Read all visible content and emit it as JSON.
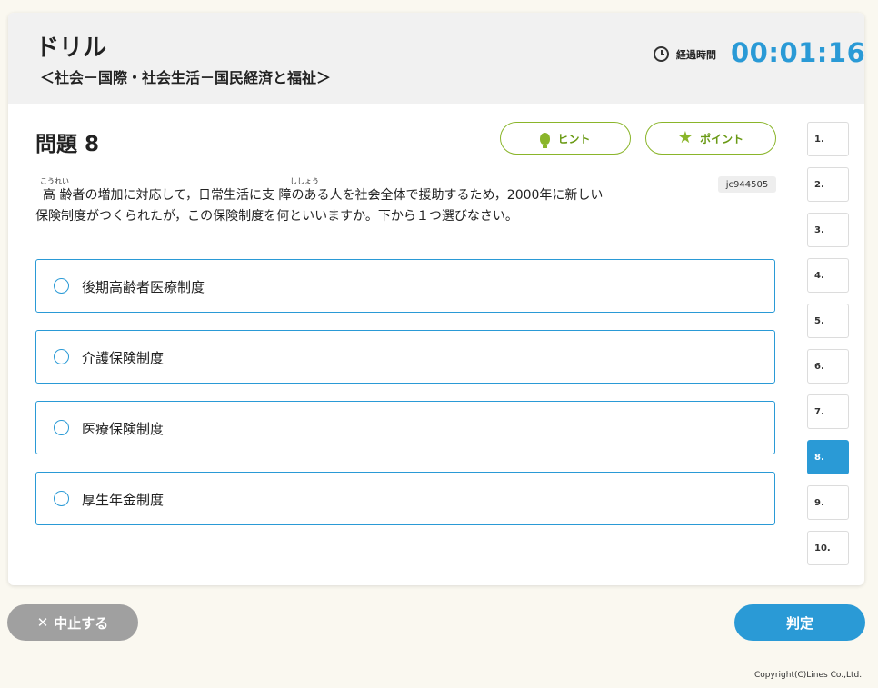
{
  "header": {
    "title": "ドリル",
    "subtitle": "＜社会－国際・社会生活－国民経済と福祉＞",
    "timer_label": "経過時間",
    "timer_value": "00:01:16"
  },
  "question": {
    "title": "問題 8",
    "hint_label": "ヒント",
    "point_label": "ポイント",
    "id": "jc944505",
    "ruby_1": "こうれい",
    "ruby_2": "ししょう",
    "text_line1": "高 齢者の増加に対応して，日常生活に支 障のある人を社会全体で援助するため，2000年に新しい",
    "text_line2": "保険制度がつくられたが，この保険制度を何といいますか。下から１つ選びなさい。"
  },
  "choices": [
    "後期高齢者医療制度",
    "介護保険制度",
    "医療保険制度",
    "厚生年金制度"
  ],
  "nav": [
    "1.",
    "2.",
    "3.",
    "4.",
    "5.",
    "6.",
    "7.",
    "8.",
    "9.",
    "10."
  ],
  "nav_active": "8.",
  "footer": {
    "stop_label": "中止する",
    "judge_label": "判定",
    "copyright": "Copyright(C)Lines Co.,Ltd."
  },
  "colors": {
    "accent": "#2a9ad6",
    "hint_green": "#8ab52a",
    "stop_gray": "#a0a0a0"
  },
  "icons": {
    "timer": "clock-icon",
    "hint": "lightbulb-icon",
    "point": "star-icon",
    "stop": "close-icon"
  }
}
